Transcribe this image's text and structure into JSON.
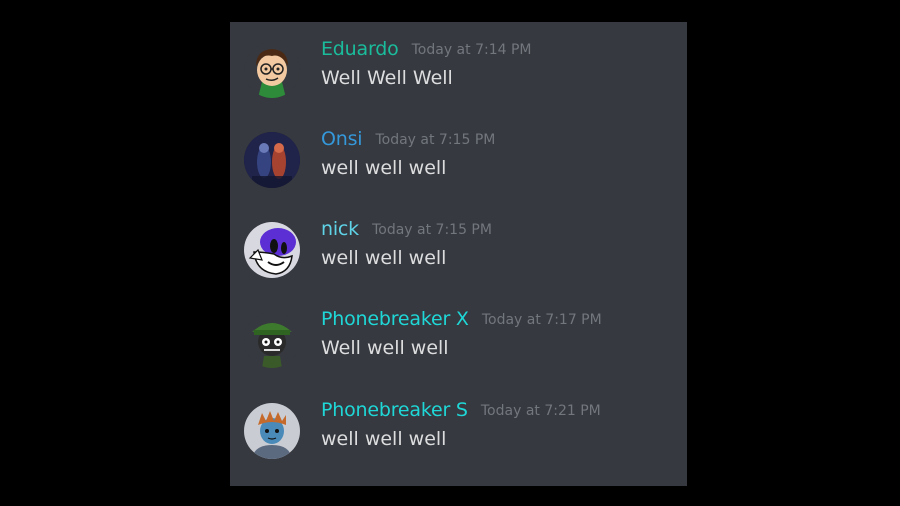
{
  "colors": {
    "background": "#000000",
    "panel": "#36393f",
    "timestamp": "#72767d",
    "message_text": "#dcddde"
  },
  "messages": [
    {
      "username": "Eduardo",
      "username_color": "#1abc9c",
      "timestamp": "Today at 7:14 PM",
      "text": "Well Well Well",
      "avatar_icon": "eduardo-avatar-icon"
    },
    {
      "username": "Onsi",
      "username_color": "#3498db",
      "timestamp": "Today at 7:15 PM",
      "text": "well well well",
      "avatar_icon": "onsi-avatar-icon"
    },
    {
      "username": "nick",
      "username_color": "#5fd3e8",
      "timestamp": "Today at 7:15 PM",
      "text": "well well well",
      "avatar_icon": "nick-avatar-icon"
    },
    {
      "username": "Phonebreaker X",
      "username_color": "#1fd7d7",
      "timestamp": "Today at 7:17 PM",
      "text": "Well well well",
      "avatar_icon": "phonebreaker-x-avatar-icon"
    },
    {
      "username": "Phonebreaker S",
      "username_color": "#1fd7d7",
      "timestamp": "Today at 7:21 PM",
      "text": "well well well",
      "avatar_icon": "phonebreaker-s-avatar-icon"
    }
  ]
}
